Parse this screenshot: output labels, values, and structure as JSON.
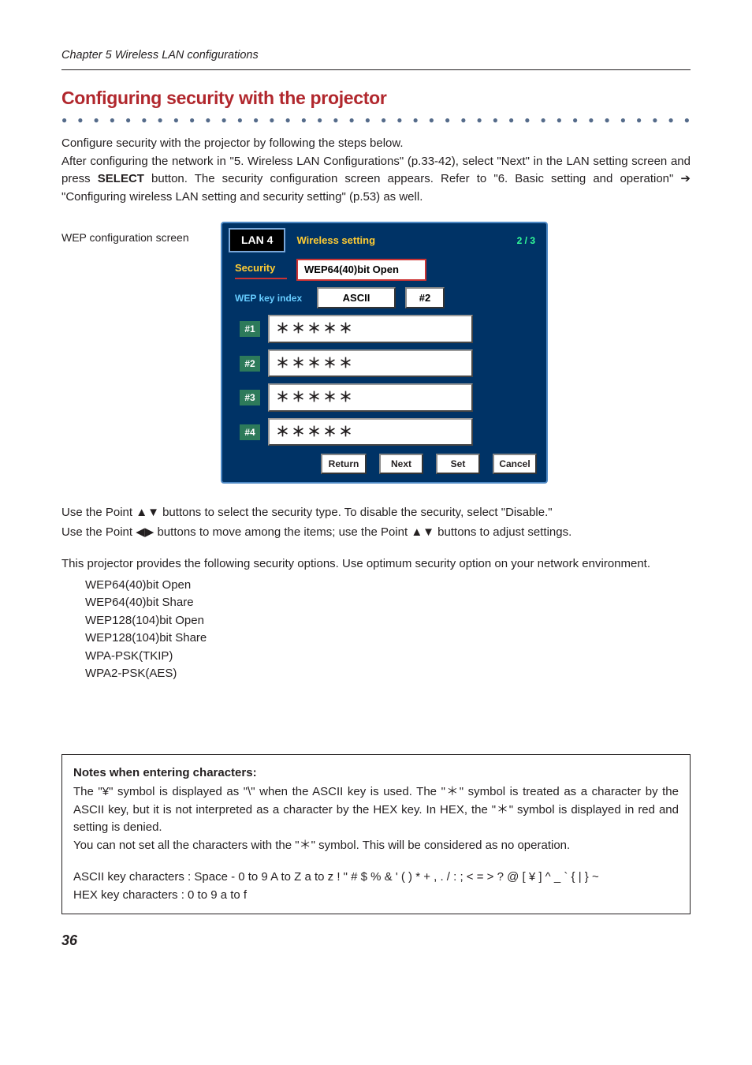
{
  "header": {
    "chapter": "Chapter 5 Wireless LAN configurations"
  },
  "title": "Configuring security with the projector",
  "intro": {
    "line1": "Configure security with the projector by following the steps below.",
    "line2_a": "After configuring the network in \"5. Wireless LAN Configurations\" (p.33-42), select \"Next\" in the LAN setting screen and press ",
    "select_word": "SELECT",
    "line2_b": " button. The security configuration screen appears. Refer to \"6. Basic setting and operation\" ",
    "arrow": "➔",
    "line2_c": " \"Configuring wireless LAN setting and security setting\" (p.53) as well."
  },
  "side_label": "WEP configuration screen",
  "osd": {
    "lan": "LAN 4",
    "wireless_setting": "Wireless setting",
    "page": "2 / 3",
    "security_label": "Security",
    "security_value": "WEP64(40)bit Open",
    "wepkey_label": "WEP key index",
    "ascii": "ASCII",
    "num": "#2",
    "keys": [
      {
        "idx": "#1",
        "val": "＊＊＊＊＊"
      },
      {
        "idx": "#2",
        "val": "＊＊＊＊＊"
      },
      {
        "idx": "#3",
        "val": "＊＊＊＊＊"
      },
      {
        "idx": "#4",
        "val": "＊＊＊＊＊"
      }
    ],
    "buttons": {
      "return": "Return",
      "next": "Next",
      "set": "Set",
      "cancel": "Cancel"
    }
  },
  "instr1_a": "Use the Point ",
  "instr1_tri": "▲▼",
  "instr1_b": " buttons to select the security type. To disable the security, select \"Disable.\"",
  "instr2_a": "Use the Point ",
  "instr2_tri1": "◀▶",
  "instr2_b": " buttons to move among the items; use the Point ",
  "instr2_tri2": "▲▼",
  "instr2_c": " buttons to adjust settings.",
  "options_intro": "This projector provides the following security options. Use optimum security option on your network environment.",
  "options": [
    "WEP64(40)bit Open",
    "WEP64(40)bit Share",
    "WEP128(104)bit Open",
    "WEP128(104)bit Share",
    "WPA-PSK(TKIP)",
    "WPA2-PSK(AES)"
  ],
  "note": {
    "title": "Notes when entering characters:",
    "p1_a": "The \"¥\" symbol is displayed as \"\\\" when the ASCII key is used. The \"",
    "ast": "＊",
    "p1_b": "\" symbol is treated as a character by the ASCII key, but it is not interpreted as a character by the HEX key. In HEX, the \"",
    "p1_c": "\" symbol is displayed in red and setting is denied.",
    "p2_a": "You can not set all the characters with the \"",
    "p2_b": "\" symbol. This will be considered as no operation.",
    "p3": "ASCII key characters : Space - 0 to 9 A to Z a to z ! \" # $ % & ' ( ) * + , . / : ; < = > ? @ [ ¥ ] ^ _ ` { | } ~",
    "p4": "HEX key characters : 0 to 9 a to f"
  },
  "page_number": "36"
}
